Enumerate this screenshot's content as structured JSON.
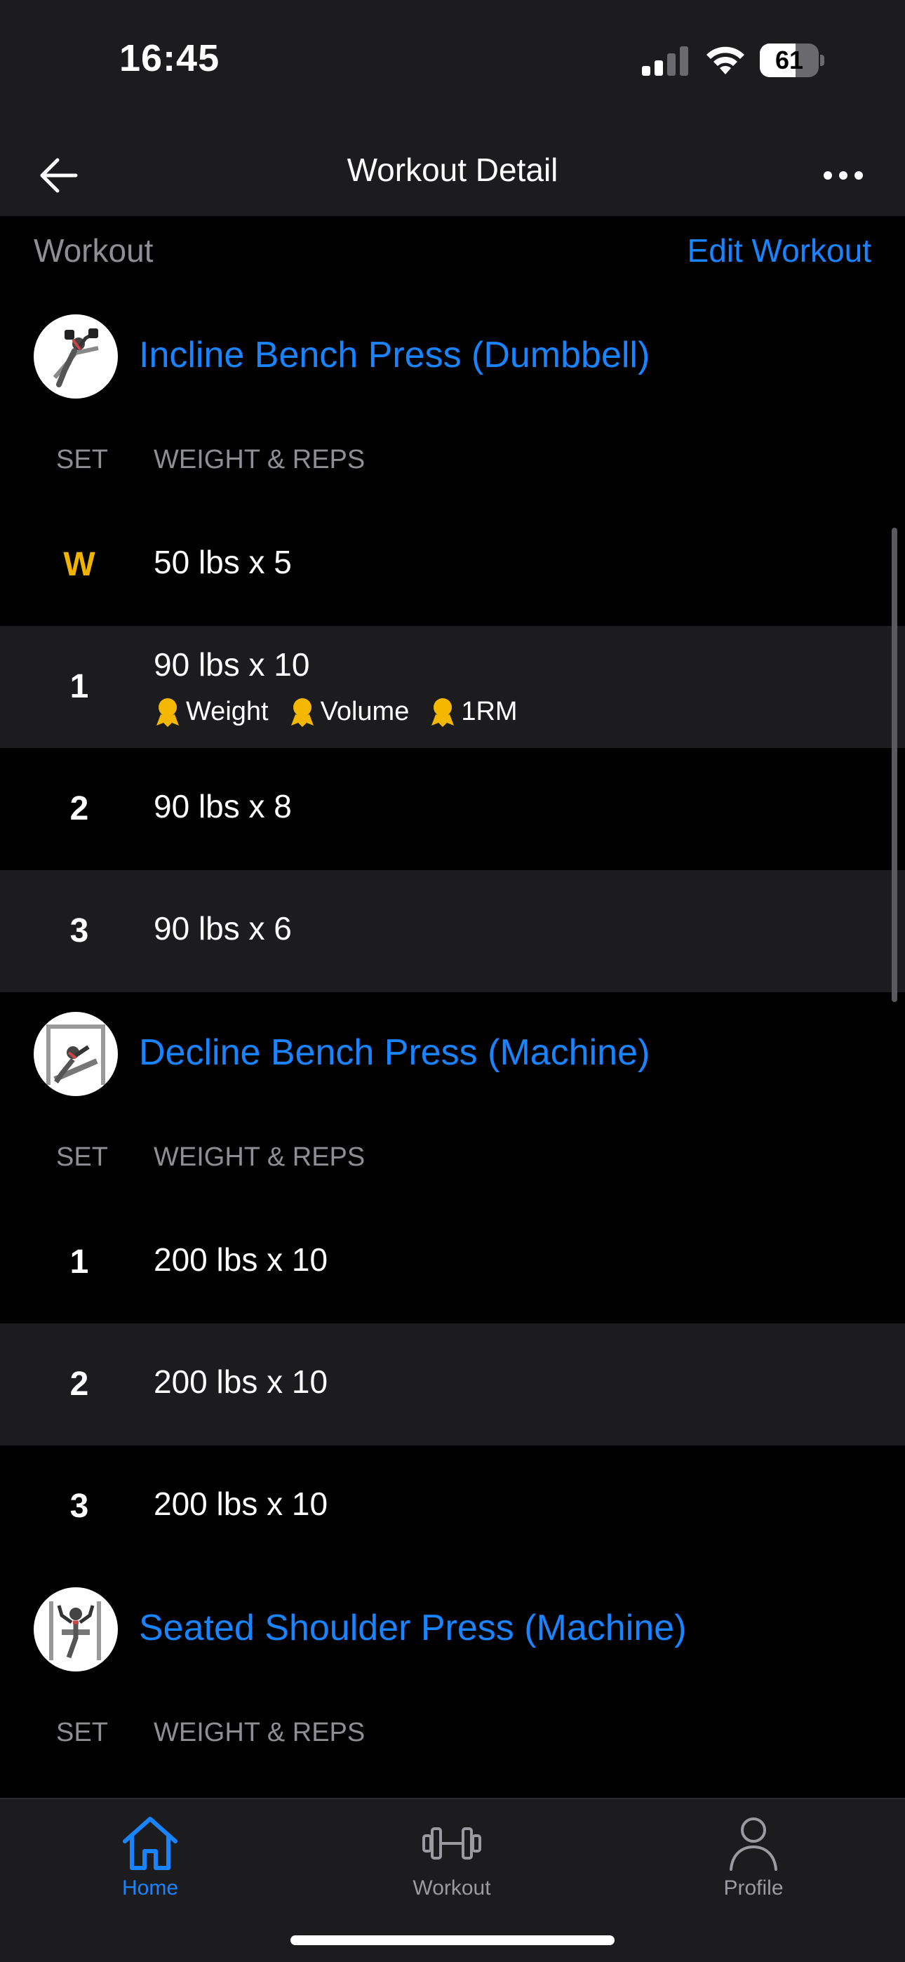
{
  "status_bar": {
    "time": "16:45",
    "battery_percent": "61",
    "battery_level": 0.61
  },
  "nav": {
    "title": "Workout Detail",
    "back_icon": "arrow-left-icon",
    "more_icon": "ellipsis-icon"
  },
  "section": {
    "label": "Workout",
    "edit_label": "Edit Workout"
  },
  "columns": {
    "set": "SET",
    "weight_reps": "WEIGHT & REPS"
  },
  "exercises": [
    {
      "name": "Incline Bench Press (Dumbbell)",
      "sets": [
        {
          "set": "W",
          "value": "50 lbs x 5"
        },
        {
          "set": "1",
          "value": "90 lbs x 10",
          "prs": [
            "Weight",
            "Volume",
            "1RM"
          ]
        },
        {
          "set": "2",
          "value": "90 lbs x 8"
        },
        {
          "set": "3",
          "value": "90 lbs x 6"
        }
      ]
    },
    {
      "name": "Decline Bench Press (Machine)",
      "sets": [
        {
          "set": "1",
          "value": "200 lbs x 10"
        },
        {
          "set": "2",
          "value": "200 lbs x 10"
        },
        {
          "set": "3",
          "value": "200 lbs x 10"
        }
      ]
    },
    {
      "name": "Seated Shoulder Press (Machine)",
      "sets": []
    }
  ],
  "tabs": {
    "home": "Home",
    "workout": "Workout",
    "profile": "Profile"
  },
  "colors": {
    "accent": "#1a84ff",
    "warmup": "#f0b400",
    "medal": "#f5b800",
    "background": "#000000",
    "surface": "#1c1c1e"
  }
}
